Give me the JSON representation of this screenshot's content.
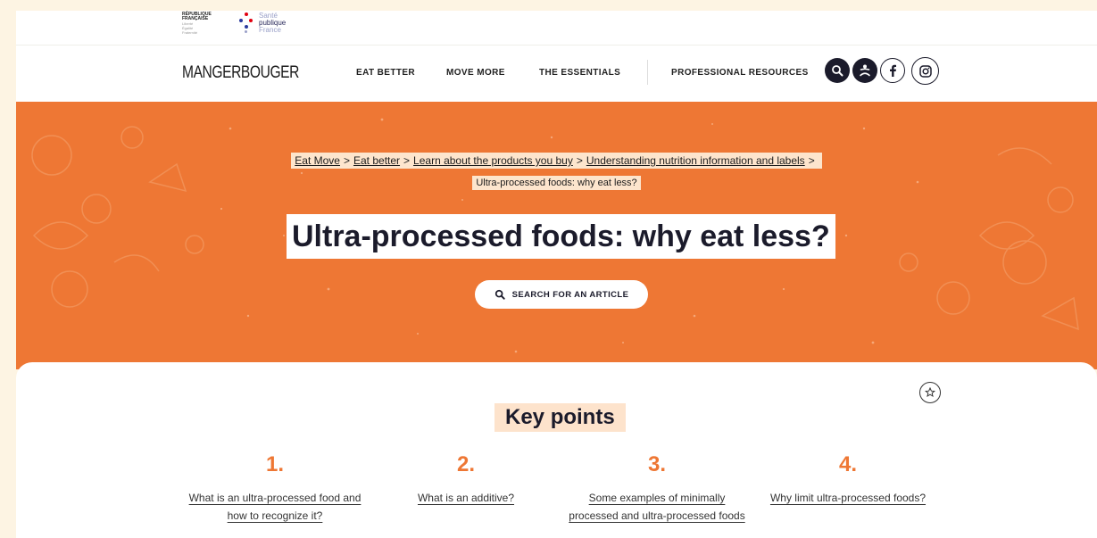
{
  "institution": {
    "rf_lines": [
      "RÉPUBLIQUE",
      "FRANÇAISE"
    ],
    "rf_motto": [
      "Liberté",
      "Égalité",
      "Fraternité"
    ],
    "spf_lines": [
      "Santé",
      "publique",
      "France"
    ]
  },
  "header": {
    "brand": "MANGERBOUGER",
    "nav": [
      "EAT BETTER",
      "MOVE MORE",
      "THE ESSENTIALS",
      "PROFESSIONAL RESOURCES"
    ],
    "icons": [
      "search-icon",
      "accessibility-icon",
      "facebook-icon",
      "instagram-icon"
    ]
  },
  "hero": {
    "breadcrumb": [
      "Eat Move",
      "Eat better",
      "Learn about the products you buy",
      "Understanding nutrition information and labels"
    ],
    "breadcrumb_separator": ">",
    "current": "Ultra-processed foods: why eat less?",
    "title": "Ultra-processed foods: why eat less?",
    "search_label": "SEARCH FOR AN ARTICLE"
  },
  "content": {
    "key_points_title": "Key points",
    "points": [
      {
        "num": "1.",
        "text": "What is an ultra-processed food and how to recognize it?"
      },
      {
        "num": "2.",
        "text": "What is an additive?"
      },
      {
        "num": "3.",
        "text": "Some examples of minimally processed and ultra-processed foods"
      },
      {
        "num": "4.",
        "text": "Why limit ultra-processed foods?"
      }
    ]
  },
  "colors": {
    "accent": "#ee7734",
    "highlight": "#fde3cc",
    "dark": "#1b1b2b",
    "background": "#fdf4e3"
  }
}
